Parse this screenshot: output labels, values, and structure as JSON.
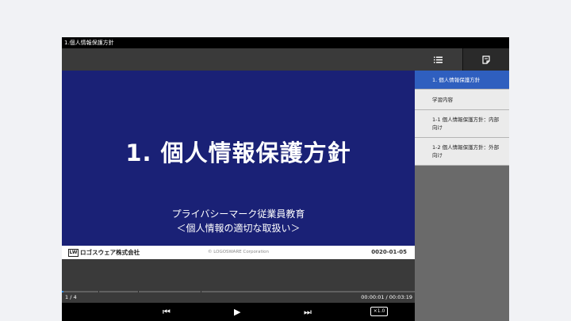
{
  "window": {
    "title": "1.個人情報保護方針"
  },
  "slide": {
    "title": "1.  個人情報保護方針",
    "subtitle_line1": "プライバシーマーク従業員教育",
    "subtitle_line2": "＜個人情報の適切な取扱い＞",
    "footer_logo_mark": "LW",
    "footer_logo_text": "ロゴスウェア株式会社",
    "footer_copyright": "© LOGOSWARE Corporation",
    "footer_date": "0020-01-05"
  },
  "player": {
    "page_indicator": "1 / 4",
    "time": "00:00:01 / 00:03:19",
    "progress_fraction": 0.005,
    "speed_label": "×1.0",
    "icons": [
      "skip-previous-icon",
      "play-icon",
      "skip-next-icon"
    ],
    "prev_glyph": "⏮",
    "play_glyph": "▶",
    "next_glyph": "⏭"
  },
  "sidebar": {
    "tabs": [
      {
        "icon": "list-icon",
        "active": true
      },
      {
        "icon": "notes-icon",
        "active": false
      }
    ],
    "items": [
      {
        "label": "1. 個人情報保護方針",
        "active": true
      },
      {
        "label": "学習内容",
        "active": false
      },
      {
        "label": "1-1 個人情報保護方針：内部向け",
        "active": false
      },
      {
        "label": "1-2 個人情報保護方針：外部向け",
        "active": false
      }
    ]
  },
  "colors": {
    "slide_background": "#1a2176",
    "active_item": "#2f5fbf",
    "seek_fill": "#2f8de4"
  }
}
